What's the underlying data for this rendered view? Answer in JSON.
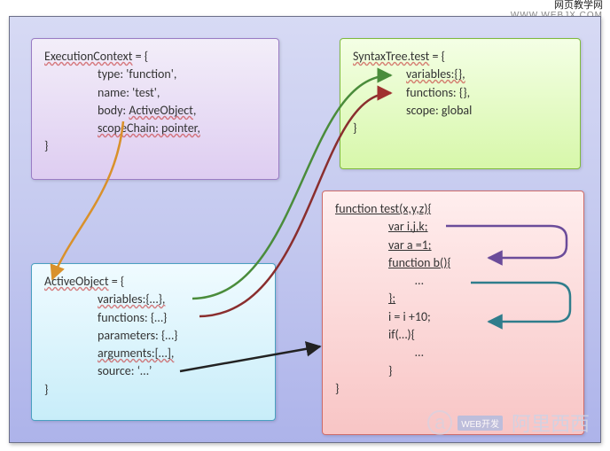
{
  "watermark": {
    "top_line1": "网页教学网",
    "top_line2": "WWW.WEBJX.COM",
    "bottom": "阿里西西",
    "bottom_tag": "WEB开发"
  },
  "ec": {
    "title": "ExecutionContext",
    "open": " = {",
    "lines": {
      "type": "type: 'function',",
      "name": "name: 'test',",
      "body_key": "body:  ",
      "body_val": "ActiveObject",
      "body_comma": ",",
      "scope": "scopeChain: pointer,"
    },
    "close": "}"
  },
  "st": {
    "title": "SyntaxTree.test",
    "open": " = {",
    "lines": {
      "vars": "variables:{},",
      "funcs": "functions: {},",
      "scope": "scope: global"
    },
    "close": "}"
  },
  "ao": {
    "title": "ActiveObject",
    "open": " = {",
    "lines": {
      "vars": "variables:{…},",
      "funcs": "functions: {…}",
      "params": "parameters: {…}",
      "args": "arguments:[…],",
      "source": "source: ‘…’"
    },
    "close": "}"
  },
  "code": {
    "l1": "function test(x,y,z){",
    "l2": "var i,j,k;",
    "l3": "var a =1;",
    "blank1": " ",
    "l4": "function b(){",
    "l5": "…",
    "l6": "};",
    "blank2": " ",
    "l7": "i = i +10;",
    "l8": "if(…){",
    "l9": "…",
    "l10": "}",
    "l11": "}"
  }
}
